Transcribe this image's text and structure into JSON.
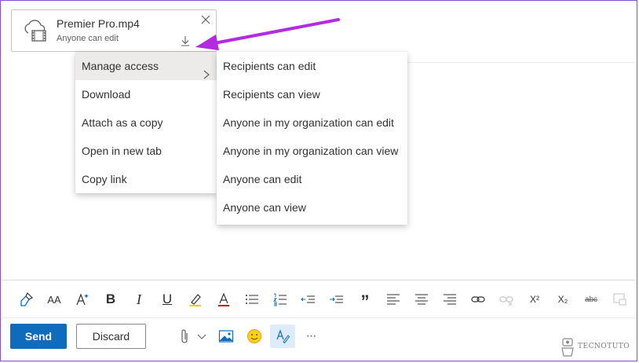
{
  "attachment": {
    "name": "Premier Pro.mp4",
    "access": "Anyone can edit",
    "icon": "cloud-video-icon"
  },
  "context_menu": {
    "items": [
      {
        "label": "Manage access",
        "has_submenu": true,
        "active": true
      },
      {
        "label": "Download"
      },
      {
        "label": "Attach as a copy"
      },
      {
        "label": "Open in new tab"
      },
      {
        "label": "Copy link"
      }
    ]
  },
  "submenu": {
    "items": [
      {
        "label": "Recipients can edit"
      },
      {
        "label": "Recipients can view"
      },
      {
        "label": "Anyone in my organization can edit"
      },
      {
        "label": "Anyone in my organization can view"
      },
      {
        "label": "Anyone can edit"
      },
      {
        "label": "Anyone can view"
      }
    ]
  },
  "toolbar": {
    "font_size_icon": "AA",
    "bold": "B",
    "italic": "I",
    "underline": "U",
    "font_color": "A",
    "quote": "”",
    "superscript": "X²",
    "subscript": "X₂",
    "strikethrough": "abc"
  },
  "actions": {
    "send": "Send",
    "discard": "Discard",
    "more": "···"
  },
  "watermark": "TECNOTUTO",
  "colors": {
    "accent": "#0f6cbd",
    "annotation_arrow": "#b32be0",
    "highlight": "#edebe9"
  }
}
